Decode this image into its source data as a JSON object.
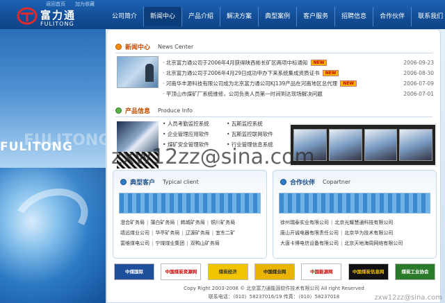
{
  "top_links": [
    "返回首页",
    "加为收藏"
  ],
  "logo": {
    "cn": "富力通",
    "en": "FULITONG"
  },
  "nav": [
    {
      "label": "公司简介",
      "active": false
    },
    {
      "label": "新闻中心",
      "active": true
    },
    {
      "label": "产品介绍",
      "active": false
    },
    {
      "label": "解决方案",
      "active": false
    },
    {
      "label": "典型案例",
      "active": false
    },
    {
      "label": "客户服务",
      "active": false
    },
    {
      "label": "招聘信息",
      "active": false
    },
    {
      "label": "合作伙伴",
      "active": false
    },
    {
      "label": "联系我们",
      "active": false
    }
  ],
  "left_brand": "FULITONG",
  "news": {
    "title_cn": "新闻中心",
    "title_en": "News Center",
    "new_badge": "NEW",
    "items": [
      {
        "text": "北京富力通公司于2006年4月获得陕西彬长矿区两项中标通知",
        "date": "2006-09-23",
        "new": true
      },
      {
        "text": "北京富力通公司于2006年4月29日成功申办下来系统集成资质证书",
        "date": "2006-08-30",
        "new": true
      },
      {
        "text": "河南华丰源科技有限公司成为北京富力通公司KJ139产品在河南地区总代理",
        "date": "2006-07-09",
        "new": true
      },
      {
        "text": "平顶山市煤矿厂系统维修，公司负责人员第一时间到达现场解决问题",
        "date": "2006-07-01",
        "new": false
      }
    ]
  },
  "products": {
    "title_cn": "产品信息",
    "title_en": "Produce Info",
    "items": [
      "人员考勤监控系统",
      "瓦斯监控系统",
      "企业管理应用软件",
      "瓦斯监控联网软件",
      "煤矿安全管理软件",
      "行业管理信息系统"
    ]
  },
  "clients": {
    "title_cn": "典型客户",
    "title_en": "Typical client",
    "rows": [
      [
        "澄合矿务局",
        "蒲白矿务局",
        "韩城矿务局",
        "铜川矿务局"
      ],
      [
        "靖远煤业公司",
        "华亭矿务局",
        "辽源矿务局",
        "宜东二矿"
      ],
      [
        "富维煤电公司",
        "宁煤煤业集团",
        "双鸭山矿务局"
      ]
    ]
  },
  "partners": {
    "title_cn": "合作伙伴",
    "title_en": "Copartner",
    "rows": [
      [
        "徐州瑞泰实业有限公司",
        "北京光耀慧通科技有限公司"
      ],
      [
        "唐山开诚电器有限责任公司",
        "北京华为技术有限公司"
      ],
      [
        "大唐卡博电信设备有限公司",
        "北京天地海周网络有限公司"
      ]
    ]
  },
  "partner_logos": [
    "中煤国际",
    "中国煤炭资源网",
    "煤炭经济",
    "中国煤业网",
    "中国能源网",
    "中国煤炭信息网",
    "煤炭工业协会"
  ],
  "footer": {
    "line1": "Copy Right 2003-2008 © 北京富力通能源软件技术有限公司 All right Reserved",
    "line2": "联系电话：（010）58237016/19  传真：（010）58237018"
  },
  "watermark": "zxw12zz@sina.com",
  "corner_mark": "zxw12zz@sina.com",
  "colors": {
    "nav_bg": "#124d96",
    "accent_orange": "#f08a12",
    "title_blue": "#1d4f8a"
  }
}
